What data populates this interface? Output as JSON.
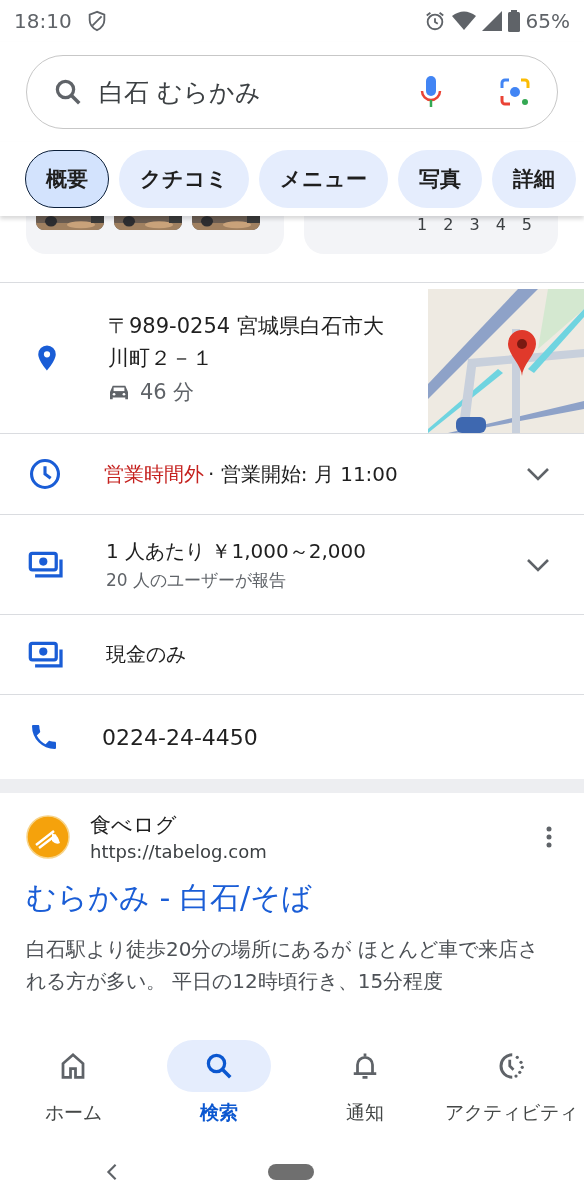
{
  "status_bar": {
    "time": "18:10",
    "battery": "65%"
  },
  "search": {
    "query": "白石 むらかみ"
  },
  "tabs": [
    {
      "label": "概要",
      "selected": true
    },
    {
      "label": "クチコミ",
      "selected": false
    },
    {
      "label": "メニュー",
      "selected": false
    },
    {
      "label": "写真",
      "selected": false
    },
    {
      "label": "詳細",
      "selected": false
    }
  ],
  "peek": {
    "rating_scale": [
      "1",
      "2",
      "3",
      "4",
      "5"
    ]
  },
  "details": [
    {
      "kind": "address",
      "text": "〒989-0254 宮城県白石市大川町２－１",
      "travel_time": "46 分"
    },
    {
      "kind": "hours",
      "status": "営業時間外",
      "text": "· 営業開始: 月 11:00",
      "expandable": true
    },
    {
      "kind": "price",
      "text": "1 人あたり ￥1,000～2,000",
      "note": "20 人のユーザーが報告",
      "expandable": true
    },
    {
      "kind": "payment",
      "text": "現金のみ"
    },
    {
      "kind": "phone",
      "text": "0224-24-4450"
    }
  ],
  "result": {
    "site_name": "食べログ",
    "url": "https://tabelog.com",
    "title": "むらかみ - 白石/そば",
    "snippet": "白石駅より徒歩20分の場所にあるが ほとんど車で来店される方が多い。 平日の12時頃行き、15分程度"
  },
  "bottom_nav": [
    {
      "kind": "home",
      "label": "ホーム",
      "selected": false
    },
    {
      "kind": "search",
      "label": "検索",
      "selected": true
    },
    {
      "kind": "bell",
      "label": "通知",
      "selected": false
    },
    {
      "kind": "activity",
      "label": "アクティビティ",
      "selected": false
    }
  ]
}
